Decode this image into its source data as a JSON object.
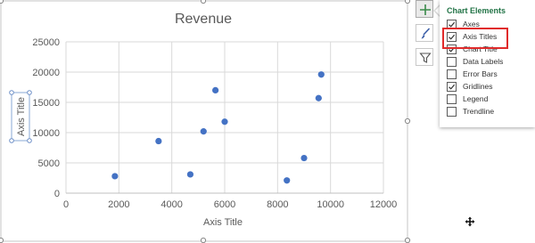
{
  "chart_data": {
    "type": "scatter",
    "title": "Revenue",
    "xlabel": "Axis Title",
    "ylabel": "Axis Title",
    "xlim": [
      0,
      12000
    ],
    "ylim": [
      0,
      25000
    ],
    "xticks": [
      0,
      2000,
      4000,
      6000,
      8000,
      10000,
      12000
    ],
    "yticks": [
      0,
      5000,
      10000,
      15000,
      20000,
      25000
    ],
    "grid": true,
    "color": "#4472c4",
    "points": [
      {
        "x": 1850,
        "y": 2800
      },
      {
        "x": 3500,
        "y": 8600
      },
      {
        "x": 4700,
        "y": 3100
      },
      {
        "x": 5200,
        "y": 10200
      },
      {
        "x": 5650,
        "y": 17000
      },
      {
        "x": 6000,
        "y": 11800
      },
      {
        "x": 8350,
        "y": 2100
      },
      {
        "x": 9000,
        "y": 5800
      },
      {
        "x": 9550,
        "y": 15700
      },
      {
        "x": 9650,
        "y": 19600
      }
    ]
  },
  "side_buttons": [
    {
      "icon": "plus-icon",
      "active": true
    },
    {
      "icon": "brush-icon",
      "active": false
    },
    {
      "icon": "filter-icon",
      "active": false
    }
  ],
  "panel": {
    "title": "Chart Elements",
    "items": [
      {
        "label": "Axes",
        "checked": true
      },
      {
        "label": "Axis Titles",
        "checked": true
      },
      {
        "label": "Chart Title",
        "checked": true
      },
      {
        "label": "Data Labels",
        "checked": false
      },
      {
        "label": "Error Bars",
        "checked": false
      },
      {
        "label": "Gridlines",
        "checked": true
      },
      {
        "label": "Legend",
        "checked": false
      },
      {
        "label": "Trendline",
        "checked": false
      }
    ]
  }
}
